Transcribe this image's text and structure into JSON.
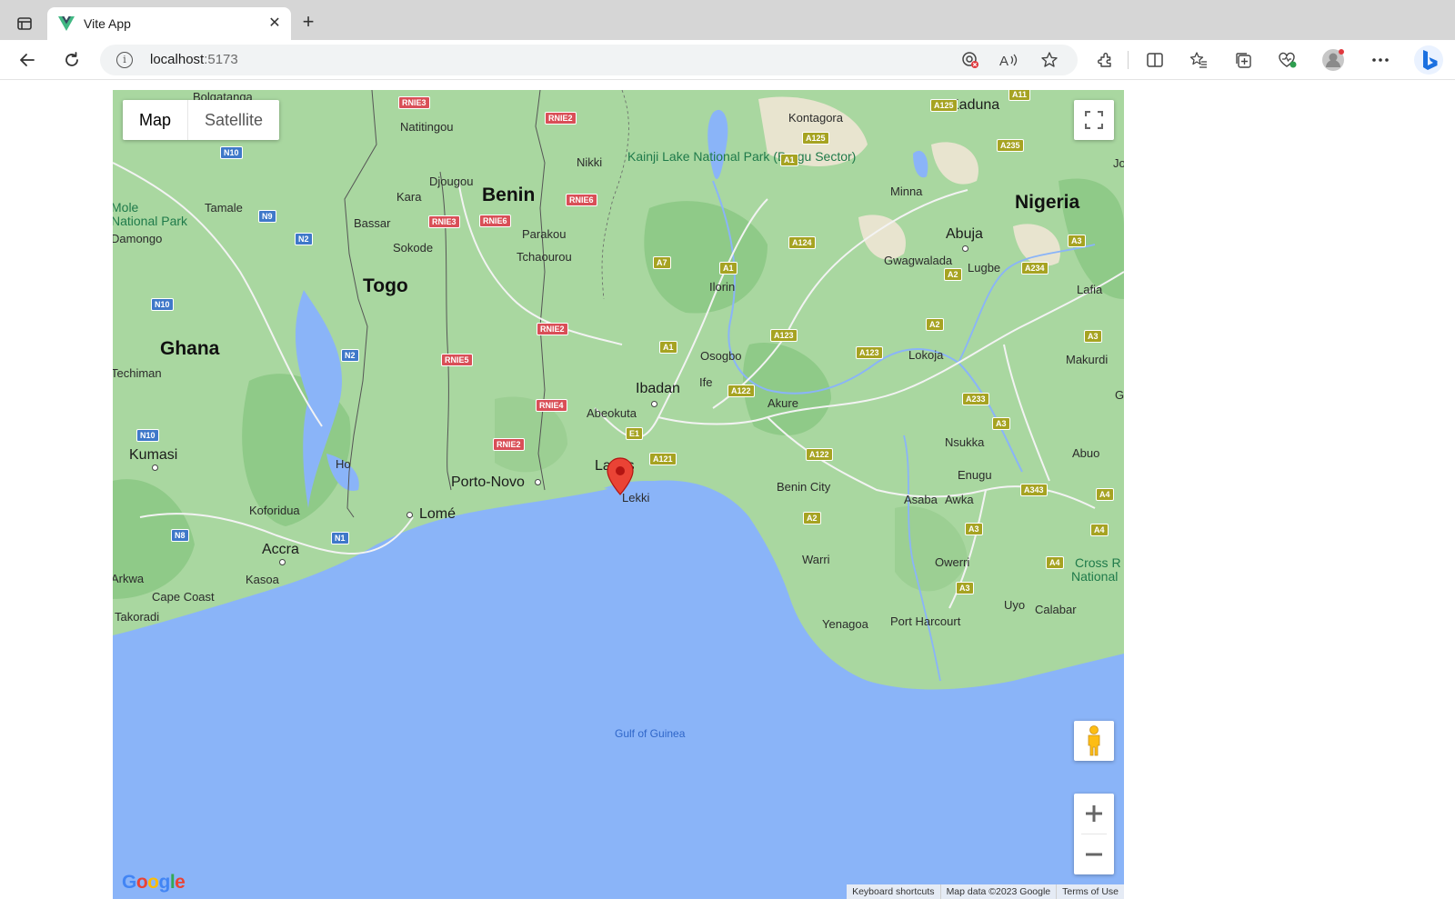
{
  "browser": {
    "tab_title": "Vite App",
    "favicon": "vue-logo-icon",
    "url_host": "localhost",
    "url_port": ":5173",
    "accent": "#1a73e8"
  },
  "map": {
    "type_buttons": [
      "Map",
      "Satellite"
    ],
    "active_type": "Map",
    "marker_city": "Lagos",
    "water_color": "#8ab4f8",
    "land_color": "#a9d7a0",
    "labels": {
      "countries": [
        "Benin",
        "Nigeria",
        "Togo",
        "Ghana"
      ],
      "cities_large": [
        "Kaduna",
        "Abuja",
        "Ibadan",
        "Lomé",
        "Porto-Novo",
        "Accra",
        "Kumasi"
      ],
      "cities": [
        "Kontagora",
        "Natitingou",
        "Nikki",
        "Djougou",
        "Kara",
        "Tamale",
        "Bassar",
        "Parakou",
        "Sokode",
        "Tchaourou",
        "Damongo",
        "Minna",
        "Gwagwalada",
        "Lugbe",
        "Lafia",
        "Ilorin",
        "Osogbo",
        "Ife",
        "Akure",
        "Lokoja",
        "Makurdi",
        "Abeokuta",
        "Nsukka",
        "Enugu",
        "Benin City",
        "Asaba",
        "Awka",
        "Lekki",
        "Koforidua",
        "Ho",
        "Warri",
        "Owerri",
        "Kasoa",
        "Cape Coast",
        "Takoradi",
        "Yenagoa",
        "Port Harcourt",
        "Uyo",
        "Calabar",
        "Abuo",
        "Cross R",
        "National",
        "Techiman",
        "Mole",
        "National Park",
        "Jo",
        "G",
        "Bolgatanga",
        "Arkwa"
      ],
      "park": "Kainji Lake National Park (Borgu Sector)",
      "sea": "Gulf of Guinea"
    },
    "shields": {
      "red": [
        "RNIE3",
        "RNIE2",
        "RNIE6",
        "RNIE3",
        "RNIE6",
        "RNIE2",
        "RNIE5",
        "RNIE4",
        "RNIE2"
      ],
      "yellow": [
        "A11",
        "A125",
        "A125",
        "A235",
        "A1",
        "A124",
        "A3",
        "A7",
        "A1",
        "A234",
        "A2",
        "A2",
        "A123",
        "A123",
        "A1",
        "A3",
        "A122",
        "A233",
        "A3",
        "A121",
        "A122",
        "A343",
        "A2",
        "A4",
        "A3",
        "A4",
        "A4",
        "A3",
        "E1"
      ],
      "blue": [
        "N10",
        "N9",
        "N2",
        "N10",
        "N2",
        "N10",
        "N8",
        "N1"
      ]
    },
    "attribution": [
      "Keyboard shortcuts",
      "Map data ©2023 Google",
      "Terms of Use"
    ],
    "google_logo": "Google"
  }
}
